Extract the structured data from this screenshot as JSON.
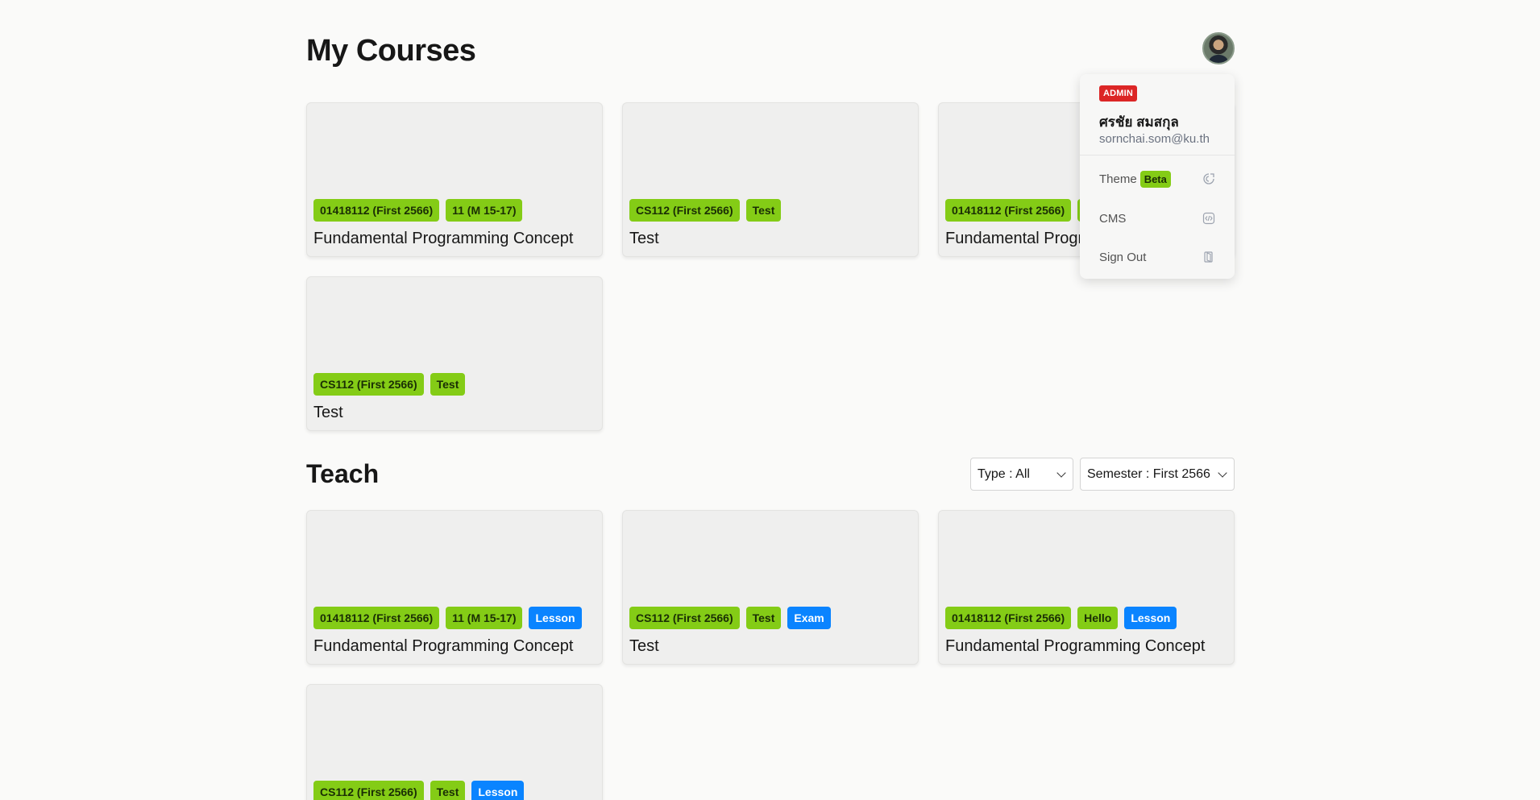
{
  "page": {
    "title": "My Courses"
  },
  "my_courses": [
    {
      "tags": [
        {
          "label": "01418112 (First 2566)",
          "color": "green"
        },
        {
          "label": "11 (M 15-17)",
          "color": "green"
        }
      ],
      "title": "Fundamental Programming Concept"
    },
    {
      "tags": [
        {
          "label": "CS112 (First 2566)",
          "color": "green"
        },
        {
          "label": "Test",
          "color": "green"
        }
      ],
      "title": "Test"
    },
    {
      "tags": [
        {
          "label": "01418112 (First 2566)",
          "color": "green"
        },
        {
          "label": "Hello",
          "color": "green"
        }
      ],
      "title": "Fundamental Programming Concept"
    },
    {
      "tags": [
        {
          "label": "CS112 (First 2566)",
          "color": "green"
        },
        {
          "label": "Test",
          "color": "green"
        }
      ],
      "title": "Test"
    }
  ],
  "teach": {
    "title": "Teach",
    "type_filter": "Type : All",
    "semester_filter": "Semester : First 2566",
    "courses": [
      {
        "tags": [
          {
            "label": "01418112 (First 2566)",
            "color": "green"
          },
          {
            "label": "11 (M 15-17)",
            "color": "green"
          },
          {
            "label": "Lesson",
            "color": "blue"
          }
        ],
        "title": "Fundamental Programming Concept"
      },
      {
        "tags": [
          {
            "label": "CS112 (First 2566)",
            "color": "green"
          },
          {
            "label": "Test",
            "color": "green"
          },
          {
            "label": "Exam",
            "color": "blue"
          }
        ],
        "title": "Test"
      },
      {
        "tags": [
          {
            "label": "01418112 (First 2566)",
            "color": "green"
          },
          {
            "label": "Hello",
            "color": "green"
          },
          {
            "label": "Lesson",
            "color": "blue"
          }
        ],
        "title": "Fundamental Programming Concept"
      },
      {
        "tags": [
          {
            "label": "CS112 (First 2566)",
            "color": "green"
          },
          {
            "label": "Test",
            "color": "green"
          },
          {
            "label": "Lesson",
            "color": "blue"
          }
        ],
        "title": ""
      }
    ]
  },
  "user_menu": {
    "role": "ADMIN",
    "name": "ศรชัย สมสกุล",
    "email": "sornchai.som@ku.th",
    "items": [
      {
        "label": "Theme",
        "badge": "Beta",
        "icon": "theme-icon"
      },
      {
        "label": "CMS",
        "icon": "code-icon"
      },
      {
        "label": "Sign Out",
        "icon": "sign-out-icon"
      }
    ]
  },
  "colors": {
    "tag_green": "#84cc16",
    "tag_blue": "#0a84ff",
    "admin_red": "#dc2626",
    "background": "#fafaf9"
  }
}
